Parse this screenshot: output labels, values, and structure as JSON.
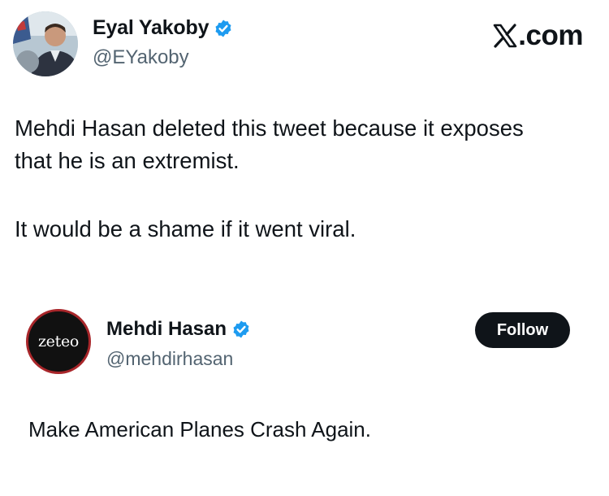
{
  "site": {
    "label": ".com",
    "icon": "x-logo-icon"
  },
  "tweet": {
    "author": {
      "name": "Eyal Yakoby",
      "handle": "@EYakoby",
      "verified": true,
      "avatar": "profile-photo"
    },
    "text_lines": [
      "Mehdi Hasan deleted this tweet because it exposes",
      "that he is an extremist.",
      "It would be a shame if it went viral."
    ]
  },
  "quoted_tweet": {
    "author": {
      "name": "Mehdi Hasan",
      "handle": "@mehdirhasan",
      "verified": true,
      "avatar_text": "zeteo"
    },
    "follow_label": "Follow",
    "text": "Make American Planes Crash Again."
  },
  "colors": {
    "verified": "#1d9bf0",
    "handle": "#536471",
    "text": "#0f1419",
    "follow_bg": "#0f1419",
    "zeteo_ring": "#a8262a"
  }
}
